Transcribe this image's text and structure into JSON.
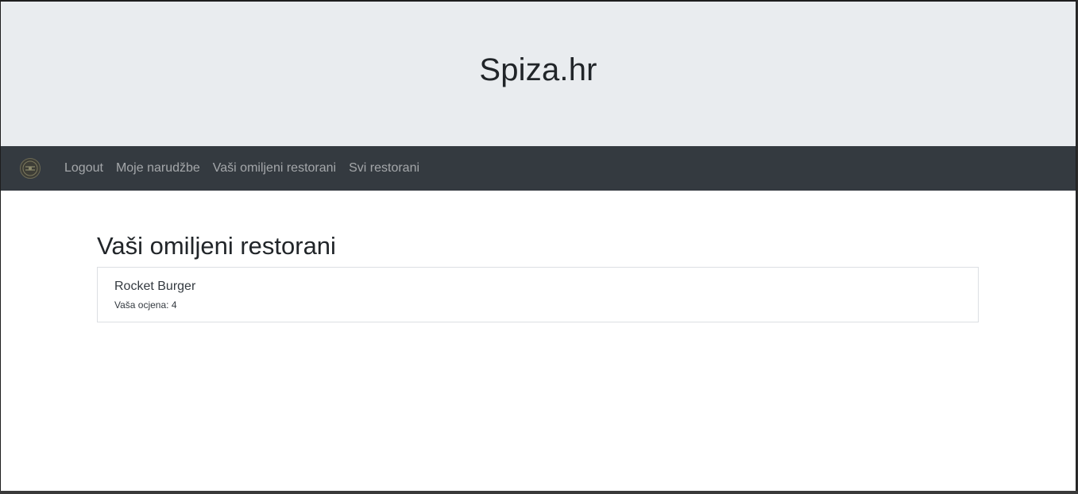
{
  "header": {
    "site_title": "Spiza.hr"
  },
  "navbar": {
    "logo_icon": "restaurant-logo-icon",
    "links": [
      {
        "label": "Logout"
      },
      {
        "label": "Moje narudžbe"
      },
      {
        "label": "Vaši omiljeni restorani"
      },
      {
        "label": "Svi restorani"
      }
    ],
    "background_color": "#343a40",
    "link_color": "rgba(255,255,255,0.55)"
  },
  "main": {
    "heading": "Vaši omiljeni restorani",
    "favorites": [
      {
        "name": "Rocket Burger",
        "rating_text": "Vaša ocjena: 4"
      }
    ]
  },
  "colors": {
    "jumbotron_bg": "#e9ecef",
    "text_dark": "#212529"
  }
}
